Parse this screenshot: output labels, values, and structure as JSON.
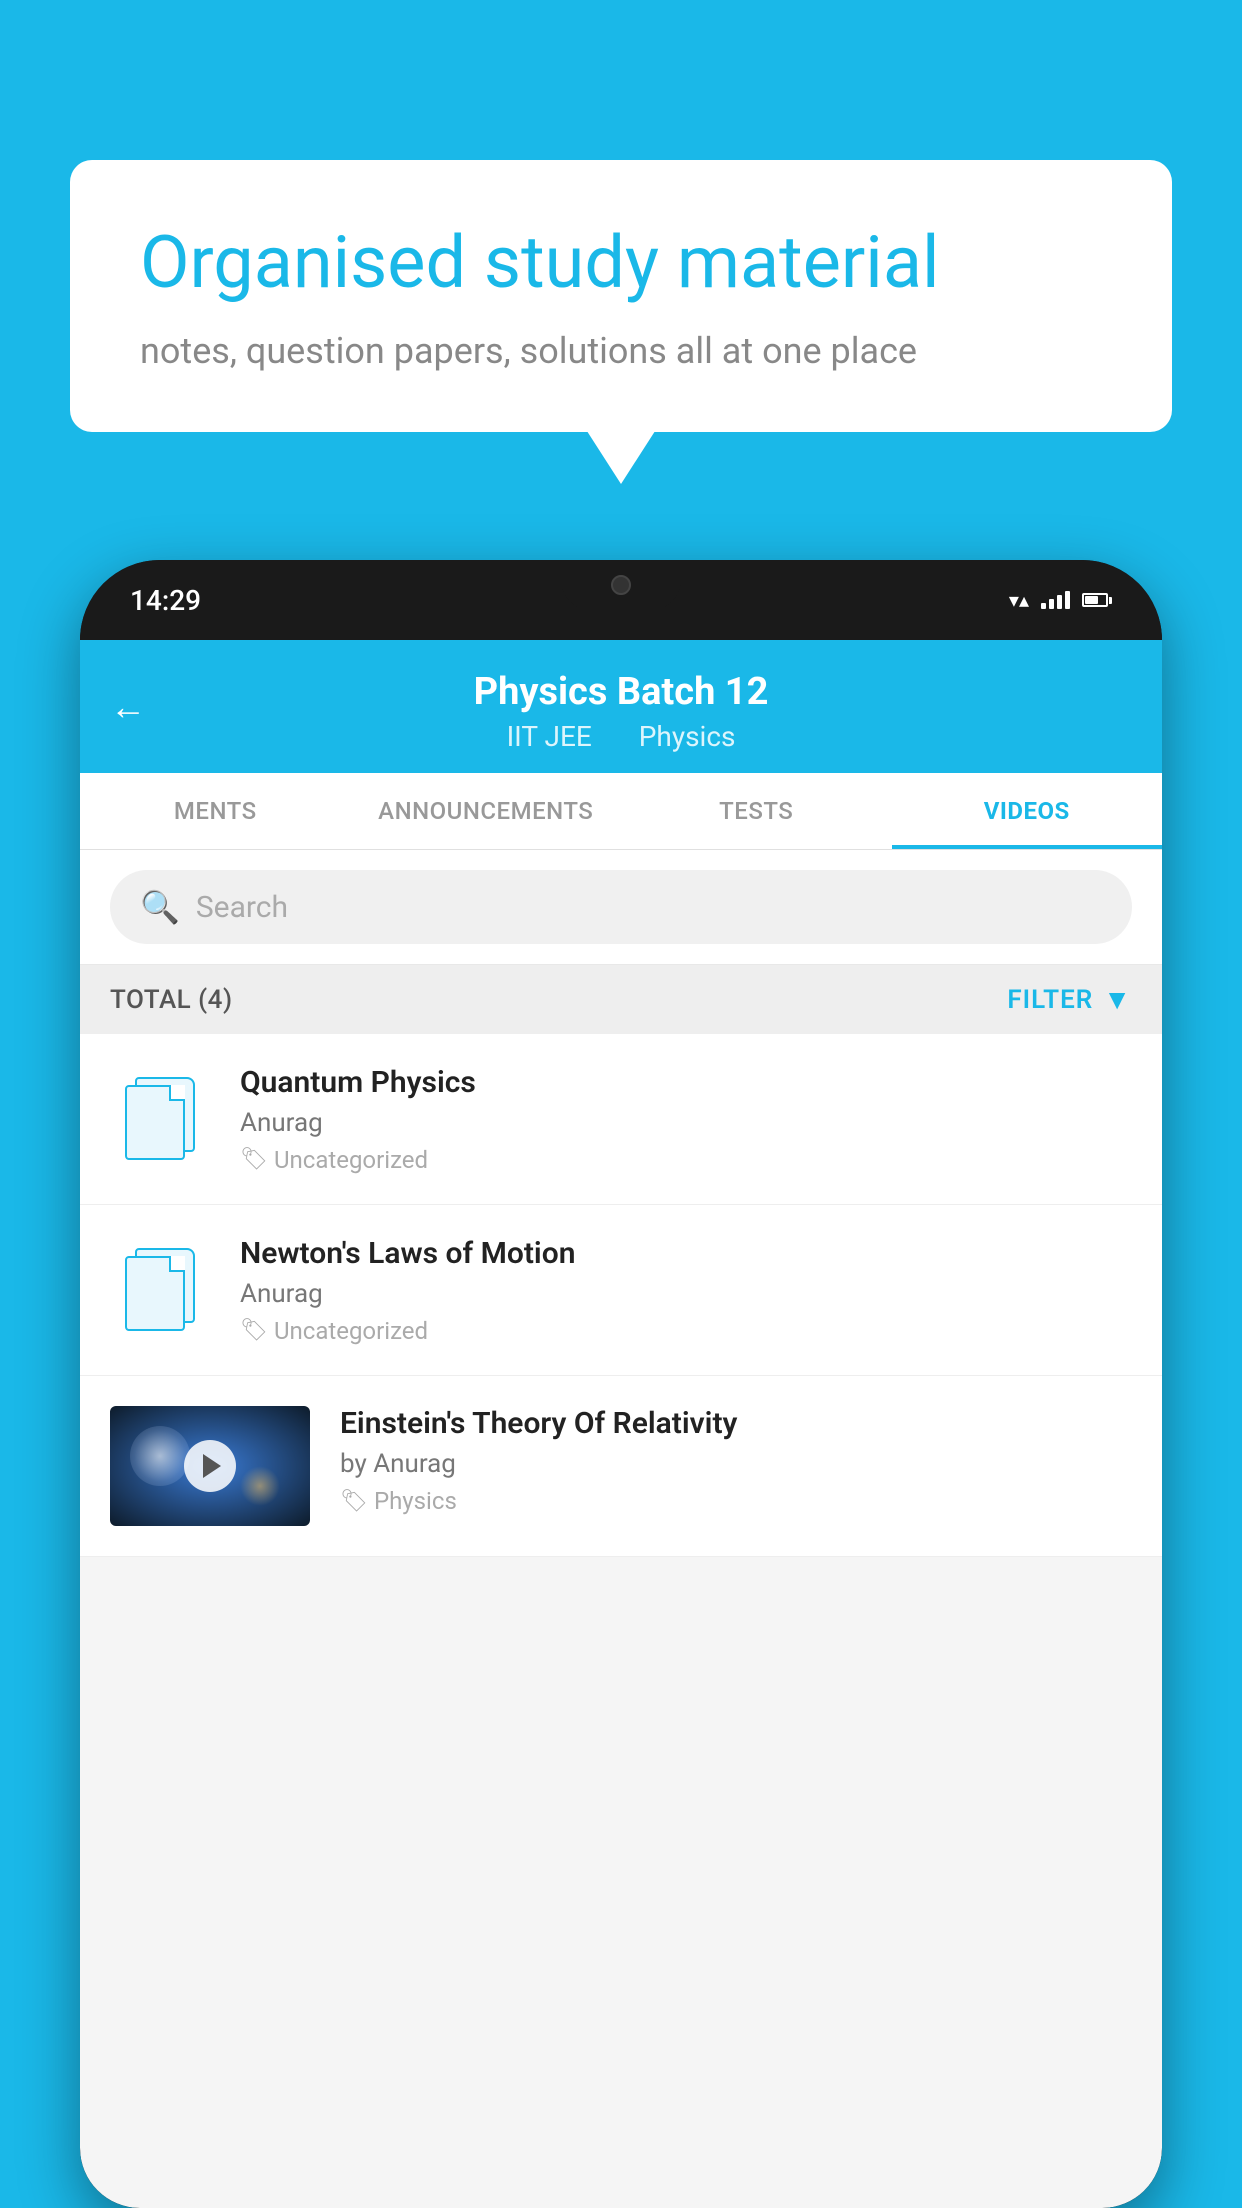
{
  "background_color": "#1ab8e8",
  "speech_bubble": {
    "title": "Organised study material",
    "subtitle": "notes, question papers, solutions all at one place"
  },
  "phone": {
    "status_bar": {
      "time": "14:29"
    },
    "header": {
      "title": "Physics Batch 12",
      "subtitle_part1": "IIT JEE",
      "subtitle_part2": "Physics",
      "back_label": "←"
    },
    "tabs": [
      {
        "label": "MENTS",
        "active": false
      },
      {
        "label": "ANNOUNCEMENTS",
        "active": false
      },
      {
        "label": "TESTS",
        "active": false
      },
      {
        "label": "VIDEOS",
        "active": true
      }
    ],
    "search": {
      "placeholder": "Search"
    },
    "filter_bar": {
      "total": "TOTAL (4)",
      "filter_label": "FILTER"
    },
    "videos": [
      {
        "title": "Quantum Physics",
        "author": "Anurag",
        "tag": "Uncategorized",
        "has_thumbnail": false
      },
      {
        "title": "Newton's Laws of Motion",
        "author": "Anurag",
        "tag": "Uncategorized",
        "has_thumbnail": false
      },
      {
        "title": "Einstein's Theory Of Relativity",
        "author": "by Anurag",
        "tag": "Physics",
        "has_thumbnail": true
      }
    ]
  }
}
